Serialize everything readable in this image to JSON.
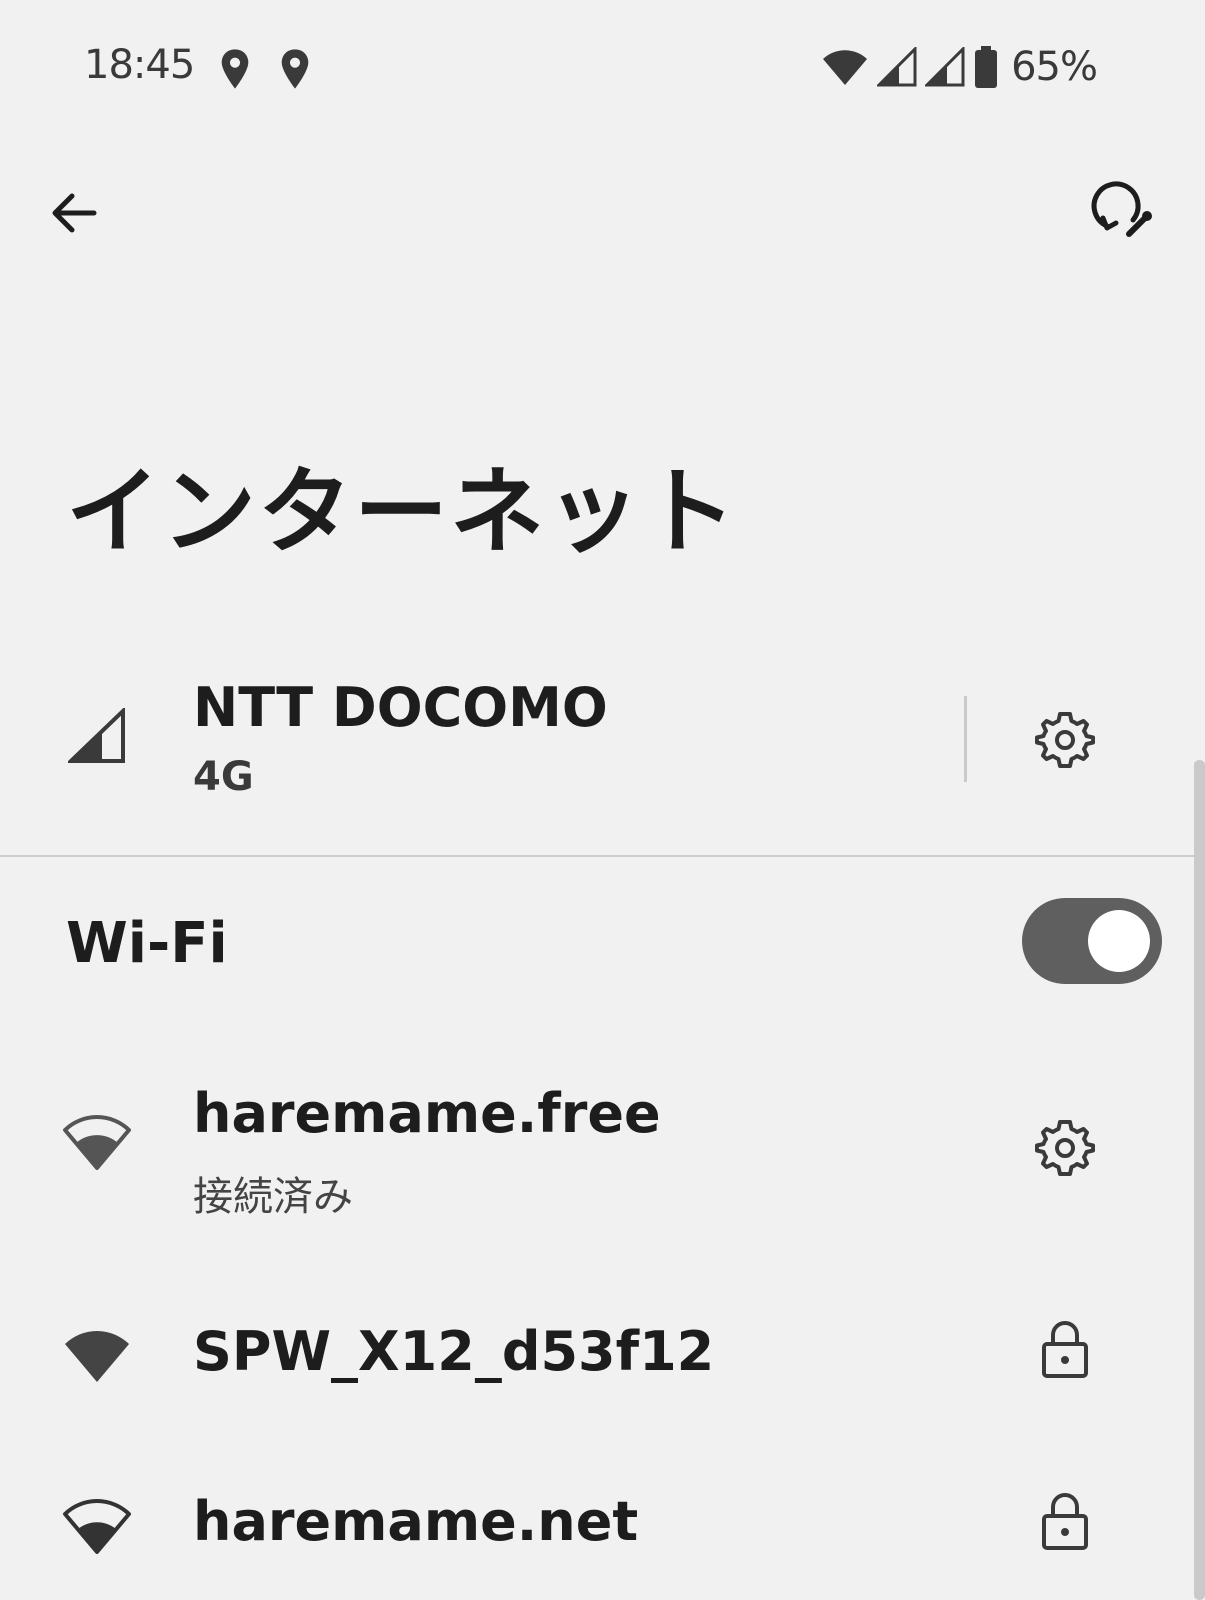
{
  "status_bar": {
    "time": "18:45",
    "battery": "65%",
    "icons": [
      "location-icon",
      "location-icon",
      "wifi-signal-icon",
      "cell-signal-icon",
      "cell-signal-icon",
      "battery-icon"
    ]
  },
  "top_bar": {
    "back_icon": "arrow-left-icon",
    "help_icon": "help-feedback-icon"
  },
  "page": {
    "title": "インターネット"
  },
  "mobile_network": {
    "carrier": "NTT DOCOMO",
    "type": "4G",
    "icon": "cell-signal-icon",
    "settings_icon": "gear-icon"
  },
  "wifi": {
    "label": "Wi-Fi",
    "enabled": true,
    "networks": [
      {
        "name": "haremame.free",
        "status": "接続済み",
        "icon": "wifi-icon",
        "action_icon": "gear-icon"
      },
      {
        "name": "SPW_X12_d53f12",
        "status": "",
        "icon": "wifi-full-icon",
        "action_icon": "lock-icon"
      },
      {
        "name": "haremame.net",
        "status": "",
        "icon": "wifi-icon",
        "action_icon": "lock-icon"
      }
    ]
  },
  "colors": {
    "background": "#f1f1f1",
    "toggle_track": "#5f5f5f",
    "text": "#1d1d1d"
  }
}
